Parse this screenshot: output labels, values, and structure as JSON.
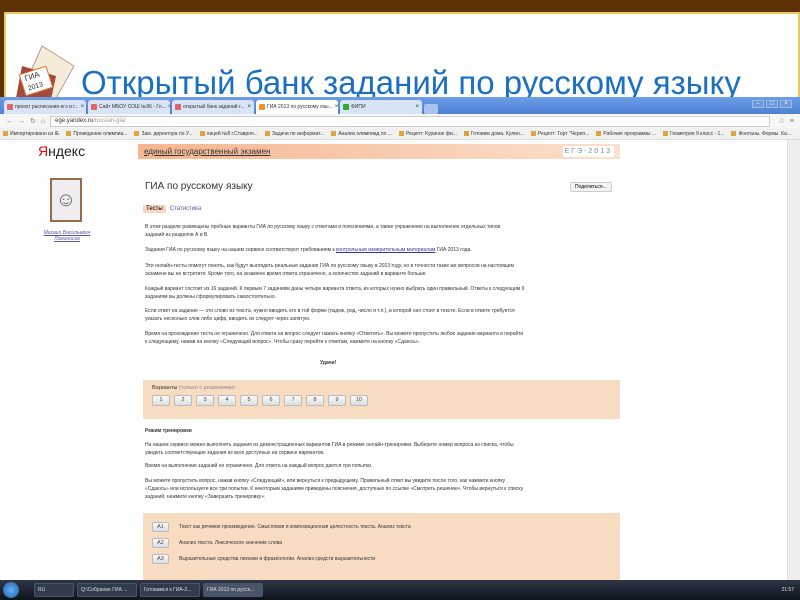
{
  "slide": {
    "title": "Открытый банк заданий по русскому языку",
    "logo_text": [
      "ГИА",
      "2013"
    ]
  },
  "browser": {
    "tabs": [
      {
        "label": "проект расписания егэ и г..."
      },
      {
        "label": "Сайт МБОУ СОШ №96 - Гл..."
      },
      {
        "label": "открытый банк заданий г..."
      },
      {
        "label": "ГИА 2013 по русскому язы...",
        "active": true
      },
      {
        "label": "ФИПИ"
      }
    ],
    "url_host": "ege.yandex.ru",
    "url_path": "/russian-gia/",
    "bookmarks": [
      "Импортировано из IE",
      "Проведение олимпиа...",
      "Зам. директора по У...",
      "лицей №8 г.Ставроп...",
      "Задачи по информат...",
      "Анализ олимпиад по ...",
      "Рецепт: Куриное фи...",
      "Готовим дома. Кулин...",
      "Рецепт: Торт \"Черeп...",
      "Рабочие программы ...",
      "Геометрия 9 класс - 1...",
      "Фонтаны. Формы. Ка..."
    ]
  },
  "page": {
    "logo_red": "Я",
    "logo_rest": "ндекс",
    "ege_header": "единый государственный экзамен",
    "ege_year": "ЕГЭ-2013",
    "portrait_caption": "Михаил Васильевич Ломоносов",
    "title": "ГИА по русскому языку",
    "share": "Поделиться...",
    "tabs": [
      "Тесты",
      "Статистика"
    ],
    "p1": "В этом разделе размещены пробные варианты ГИА по русскому языку с ответами и пояснениями, а также упражнения на выполнение отдельных типов заданий из разделов А и В.",
    "p2_pre": "Задания ГИА по русскому языку на нашем сервисе соответствуют требованиям к ",
    "p2_link": "контрольным измерительным материалам",
    "p2_post": " ГИА 2013 года.",
    "p3": "Эти онлайн-тесты помогут понять, как будут выглядеть реальные задания ГИА по русскому языку в 2013 году, но в точности таких же вопросов на настоящем экзамене вы не встретите. Кроме того, на экзамене время ответа ограничено, а количество заданий в варианте больше.",
    "p4": "Каждый вариант состоит из 16 заданий. К первым 7 заданиям даны четыре варианта ответа, из которых нужно выбрать один правильный. Ответы к следующим 9 заданиям вы должны сформулировать самостоятельно.",
    "p5": "Если ответ на задание — это слово из текста, нужно вводить его в той форме (падеж, род, число и т.п.), в которой оно стоит в тексте. Если в ответе требуется указать несколько слов либо цифр, вводить их следует через запятую.",
    "p6": "Время на прохождение теста не ограничено. Для ответа на вопрос следует нажать кнопку «Ответить». Вы можете пропустить любое задание варианта и перейти к следующему, нажав на кнопку «Следующий вопрос». Чтобы сразу перейти к ответам, нажмите на кнопку «Сдаюсь».",
    "luck": "Удачи!",
    "variants_label": "Варианты",
    "variants_filter": "(только с решениями)",
    "variants": [
      "1",
      "2",
      "3",
      "4",
      "5",
      "6",
      "7",
      "8",
      "9",
      "10"
    ],
    "training_title": "Режим тренировки",
    "t1": "На нашем сервисе можно выполнять задания из демонстрационных вариантов ГИА в режиме онлайн-тренировки. Выберите номер вопроса из списка, чтобы увидеть соответствующие задания из всех доступных на сервисе вариантов.",
    "t2": "Время на выполнение заданий не ограничено. Для ответа на каждый вопрос дается три попытки.",
    "t3": "Вы можете пропустить вопрос, нажав кнопку «Следующий», или вернуться к предыдущему. Правильный ответ вы увидите после того, как нажмете кнопку «Сдаюсь» или используете все три попытки. К некоторым заданиям приведены пояснения, доступные по ссылке «Смотреть решение». Чтобы вернуться к списку заданий, нажмите кнопку «Завершить тренировку».",
    "topics": [
      {
        "code": "A1",
        "text": "Текст как речевое произведение. Смысловая и композиционная целостность текста. Анализ текста"
      },
      {
        "code": "A2",
        "text": "Анализ текста. Лексическое значение слова"
      },
      {
        "code": "A3",
        "text": "Выразительные средства лексики и фразеологии. Анализ средств выразительности"
      }
    ]
  },
  "taskbar": {
    "items": [
      "RU",
      "Q:\\Собрание ГИА ...",
      "Готовимся к ГИА-2...",
      "ГИА 2013 по русск..."
    ],
    "clock": "21:57"
  }
}
